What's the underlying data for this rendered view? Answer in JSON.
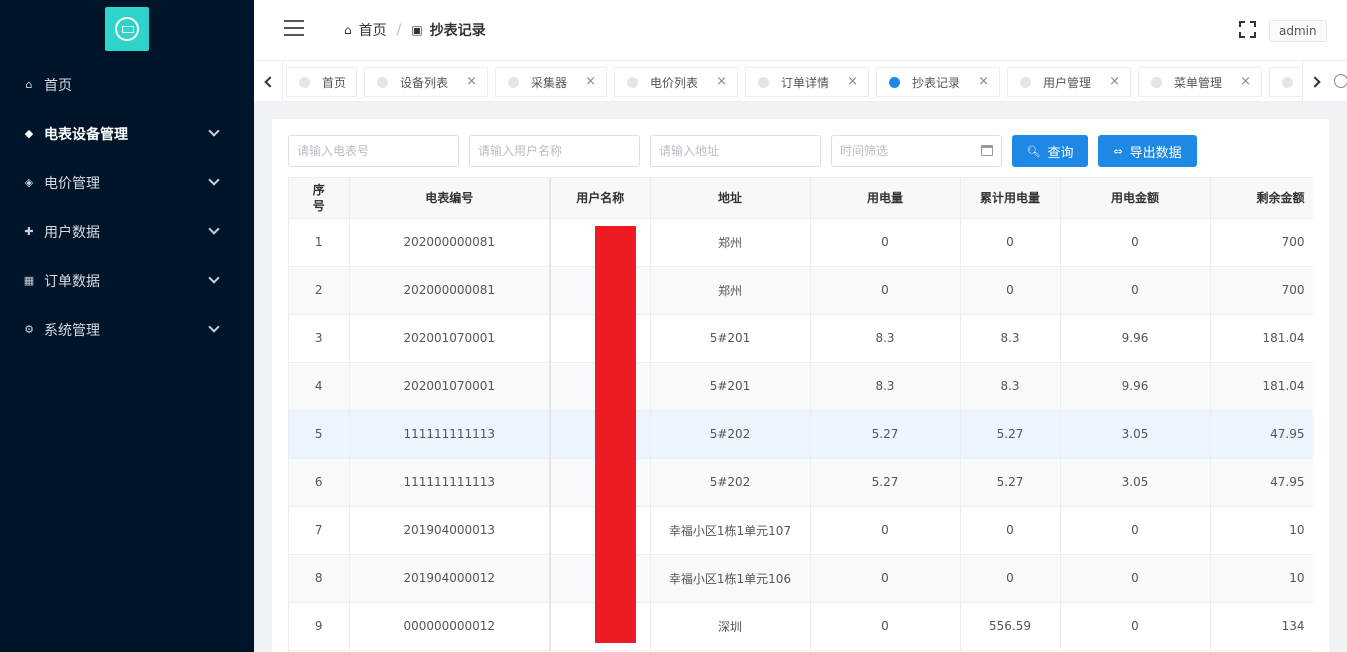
{
  "sidebar": {
    "logo_icon": "meter-logo-icon",
    "items": [
      {
        "label": "首页",
        "icon": "home-icon",
        "glyph": "⌂",
        "has_children": false,
        "active": false
      },
      {
        "label": "电表设备管理",
        "icon": "device-icon",
        "glyph": "◆",
        "has_children": true,
        "active": true
      },
      {
        "label": "电价管理",
        "icon": "shield-icon",
        "glyph": "◈",
        "has_children": true,
        "active": false
      },
      {
        "label": "用户数据",
        "icon": "puzzle-icon",
        "glyph": "✚",
        "has_children": true,
        "active": false
      },
      {
        "label": "订单数据",
        "icon": "grid-icon",
        "glyph": "▦",
        "has_children": true,
        "active": false
      },
      {
        "label": "系统管理",
        "icon": "settings-icon",
        "glyph": "⚙",
        "has_children": true,
        "active": false
      }
    ]
  },
  "header": {
    "breadcrumb": [
      {
        "label": "首页",
        "icon": "home-icon",
        "glyph": "⌂"
      },
      {
        "label": "抄表记录",
        "icon": "image-icon",
        "glyph": "▣"
      }
    ],
    "separator": "/",
    "user": "admin"
  },
  "tabs": [
    {
      "label": "首页",
      "active": false,
      "closable": false
    },
    {
      "label": "设备列表",
      "active": false,
      "closable": true
    },
    {
      "label": "采集器",
      "active": false,
      "closable": true
    },
    {
      "label": "电价列表",
      "active": false,
      "closable": true
    },
    {
      "label": "订单详情",
      "active": false,
      "closable": true
    },
    {
      "label": "抄表记录",
      "active": true,
      "closable": true
    },
    {
      "label": "用户管理",
      "active": false,
      "closable": true
    },
    {
      "label": "菜单管理",
      "active": false,
      "closable": true
    },
    {
      "label": "",
      "active": false,
      "closable": false
    }
  ],
  "filters": {
    "meter_no_placeholder": "请输入电表号",
    "user_name_placeholder": "请输入用户名称",
    "address_placeholder": "请输入地址",
    "time_placeholder": "时间筛选",
    "search_label": "查询",
    "export_label": "导出数据"
  },
  "table": {
    "headers": [
      "序号",
      "电表编号",
      "用户名称",
      "地址",
      "用电量",
      "累计用电量",
      "用电金额",
      "剩余金额"
    ],
    "rows": [
      [
        "1",
        "202000000081",
        "",
        "郑州",
        "0",
        "0",
        "0",
        "700"
      ],
      [
        "2",
        "202000000081",
        "",
        "郑州",
        "0",
        "0",
        "0",
        "700"
      ],
      [
        "3",
        "202001070001",
        "",
        "5#201",
        "8.3",
        "8.3",
        "9.96",
        "181.04"
      ],
      [
        "4",
        "202001070001",
        "",
        "5#201",
        "8.3",
        "8.3",
        "9.96",
        "181.04"
      ],
      [
        "5",
        "111111111113",
        "",
        "5#202",
        "5.27",
        "5.27",
        "3.05",
        "47.95"
      ],
      [
        "6",
        "111111111113",
        "",
        "5#202",
        "5.27",
        "5.27",
        "3.05",
        "47.95"
      ],
      [
        "7",
        "201904000013",
        "",
        "幸福小区1栋1单元107",
        "0",
        "0",
        "0",
        "10"
      ],
      [
        "8",
        "201904000012",
        "",
        "幸福小区1栋1单元106",
        "0",
        "0",
        "0",
        "10"
      ],
      [
        "9",
        "000000000012",
        "",
        "深圳",
        "0",
        "556.59",
        "0",
        "134"
      ]
    ]
  },
  "colors": {
    "sidebar_bg": "#001529",
    "logo_bg": "#2ed3c9",
    "primary": "#1e88e5",
    "redaction": "#ed1c24"
  }
}
